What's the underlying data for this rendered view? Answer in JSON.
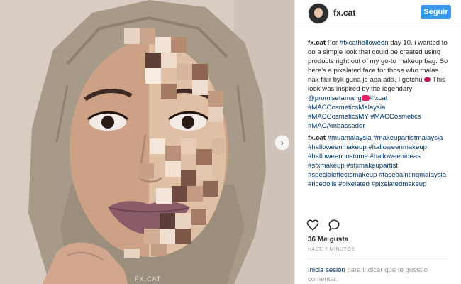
{
  "post": {
    "watermark": "FX.CAT",
    "next_icon": "chevron-right-icon"
  },
  "header": {
    "username": "fx.cat",
    "follow_label": "Seguir"
  },
  "comments": [
    {
      "author": "fx.cat",
      "text_1": " For ",
      "tag_1": "#fxcathalloween",
      "text_2": " day 10, i wanted to do a simple look that could be created using products right out of my go-to makeup bag. So here's a pixelated face for those who malas nak fikir byk guna je apa ada. I gotchu ",
      "text_3": " This look was inspired by the legendary ",
      "mention": "@promisetamang",
      "text_4": " ",
      "tag_2": "#fxcat",
      "tag_3": "#MACCosmeticsMalaysia",
      "tag_4": "#MACCosmeticsMY",
      "tag_5": "#MACCosmetics",
      "tag_6": "#MACAmbassador"
    },
    {
      "author": "fx.cat",
      "tags": "#muamalaysia #makeupartistmalaysia #halloweenmakeup #halloweenmakeup #halloweencostume #halloweenideas #sfxmakeup #sfxmakeupartist #specialeffectsmakeup #facepaintingmalaysia #ricedolls #pixelated #pixelatedmakeup"
    }
  ],
  "actions": {
    "like_icon": "heart-icon",
    "comment_icon": "comment-icon",
    "likes": "36 Me gusta",
    "time": "HACE 7 MINUTOS"
  },
  "login": {
    "link": "Inicia sesión",
    "text": " para indicar que te gusta o comentar."
  },
  "colors": {
    "follow_button": "#3897f0",
    "link": "#003569",
    "hijab": "#a79a88"
  }
}
